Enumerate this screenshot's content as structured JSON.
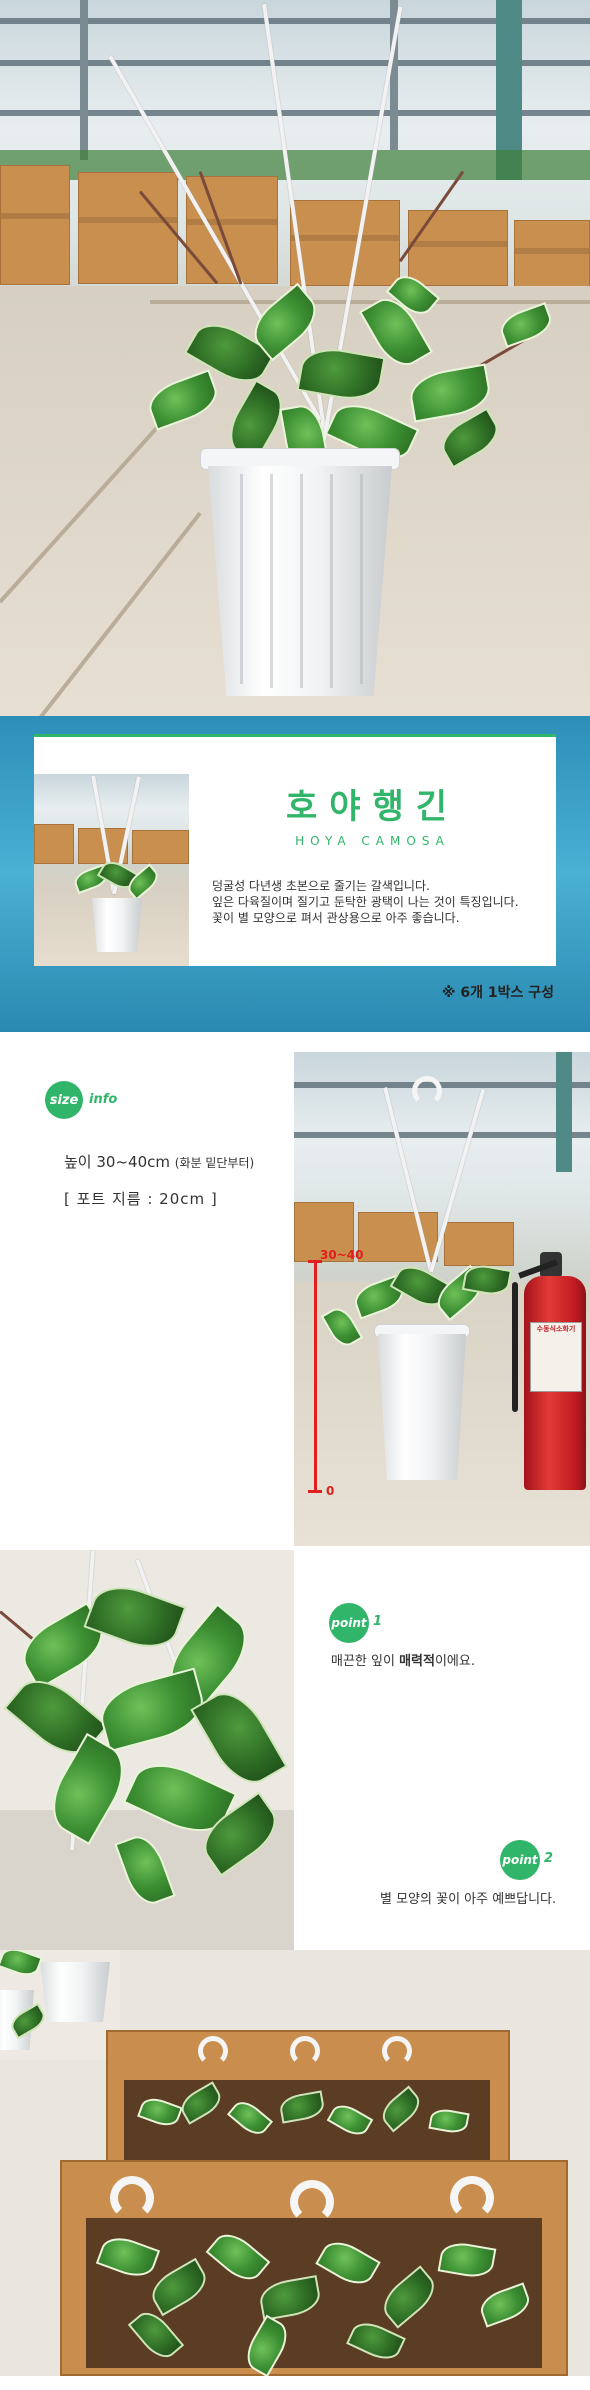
{
  "title": {
    "name_ko": "호야행긴",
    "name_en": "HOYA CAMOSA",
    "description": [
      "덩굴성 다년생 초본으로 줄기는 갈색입니다.",
      "잎은 다육질이며 질기고 둔탁한 광택이 나는 것이 특징입니다.",
      "꽃이 별 모양으로 펴서 관상용으로 아주 좋습니다."
    ],
    "box_note": "※ 6개 1박스 구성"
  },
  "size": {
    "badge": "size",
    "badge_suffix": "info",
    "height_value": "높이 30~40cm",
    "height_note": "(화분 밑단부터)",
    "pot_diameter": "[ 포트 지름 : 20cm ]",
    "scale_top": "30~40",
    "scale_bottom": "0",
    "extinguisher_label": "수동식소화기"
  },
  "points": [
    {
      "badge": "point",
      "number": "1",
      "text_before": "매끈한 잎이 ",
      "text_bold": "매력적",
      "text_after": "이에요."
    },
    {
      "badge": "point",
      "number": "2",
      "text": "별 모양의 꽃이 아주 예쁘답니다."
    }
  ],
  "colors": {
    "accent_green": "#31b56a",
    "scale_red": "#e0201e",
    "title_bg": "#4ab0d4"
  }
}
